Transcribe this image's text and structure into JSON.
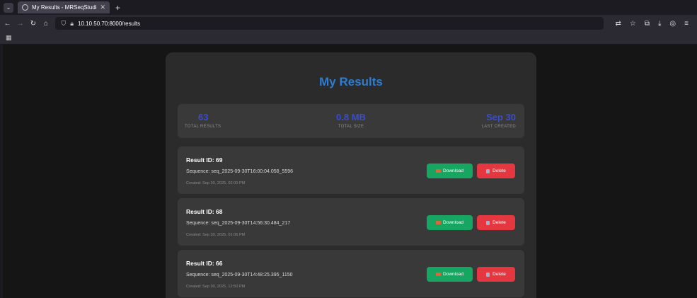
{
  "browser": {
    "tab_title": "My Results - MRSeqStudio",
    "url": "10.10.50.70:8000/results",
    "icons": [
      "tab-list-icon",
      "back-icon",
      "forward-icon",
      "reload-icon",
      "home-icon",
      "shield-icon",
      "lock-icon",
      "translate-icon",
      "star-icon",
      "extensions-icon",
      "download-icon",
      "account-icon",
      "menu-icon",
      "apps-icon"
    ]
  },
  "page": {
    "title": "My Results",
    "stats": [
      {
        "value": "63",
        "label": "TOTAL RESULTS"
      },
      {
        "value": "0.8 MB",
        "label": "TOTAL SIZE"
      },
      {
        "value": "Sep 30",
        "label": "LAST CREATED"
      }
    ],
    "results": [
      {
        "id_label": "Result ID: 69",
        "sequence": "Sequence: seq_2025-09-30T16:00:04.058_5596",
        "created": "Created: Sep 30, 2025, 02:00 PM"
      },
      {
        "id_label": "Result ID: 68",
        "sequence": "Sequence: seq_2025-09-30T14:56:30.484_217",
        "created": "Created: Sep 30, 2025, 01:06 PM"
      },
      {
        "id_label": "Result ID: 66",
        "sequence": "Sequence: seq_2025-09-30T14:48:25.395_1150",
        "created": "Created: Sep 30, 2025, 12:50 PM"
      }
    ],
    "download_label": "Download",
    "delete_label": "Delete",
    "colors": {
      "accent": "#2f7cd1",
      "stat_value": "#3a4dc9",
      "download": "#17a562",
      "delete": "#e5373f"
    }
  }
}
